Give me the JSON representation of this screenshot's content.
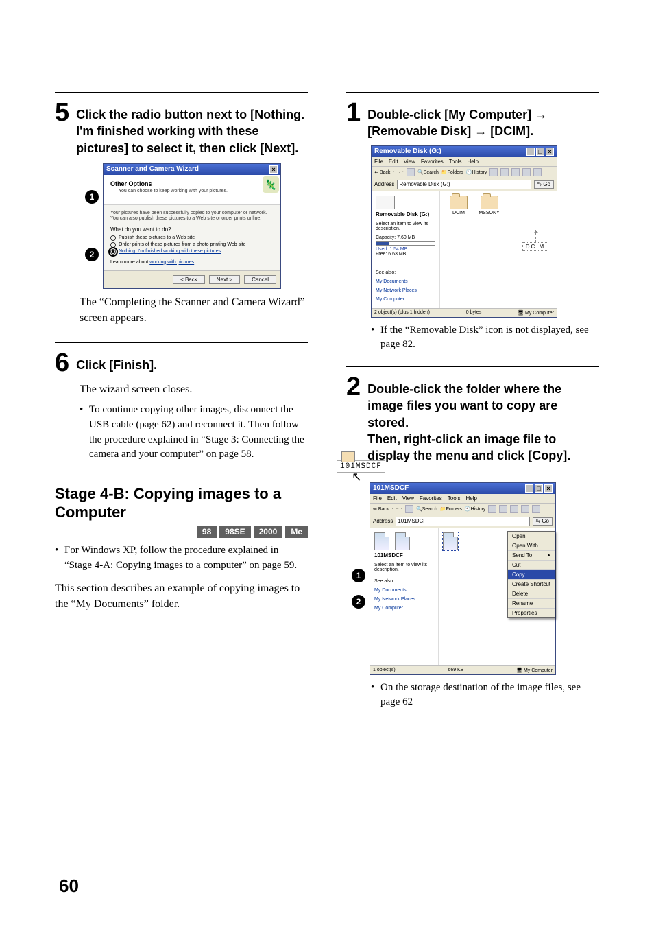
{
  "page_number": "60",
  "left": {
    "step5": {
      "num": "5",
      "text": "Click the radio button next to [Nothing. I'm finished working with these pictures] to select it, then click [Next].",
      "after": "The “Completing the Scanner and Camera Wizard” screen appears."
    },
    "step6": {
      "num": "6",
      "text": "Click [Finish].",
      "after": "The wizard screen closes.",
      "bullet": "To continue copying other images, disconnect the USB cable (page 62) and reconnect it. Then follow the procedure explained in “Stage 3: Connecting the camera and your computer” on page 58."
    },
    "stage": {
      "title": "Stage 4-B: Copying images to a Computer",
      "os": [
        "98",
        "98SE",
        "2000",
        "Me"
      ],
      "bullet": "For Windows XP, follow the procedure explained in “Stage 4-A: Copying images to a computer” on page 59.",
      "body": "This section describes an example of copying images to the “My Documents” folder."
    },
    "callouts": [
      "1",
      "2"
    ]
  },
  "right": {
    "step1": {
      "num": "1",
      "text": "Double-click [My Computer] → [Removable Disk] → [DCIM].",
      "bullet": "If the “Removable Disk” icon is not displayed, see page 82."
    },
    "step2": {
      "num": "2",
      "text": "Double-click the folder where the image files you want to copy are stored.\nThen, right-click an image file to display the menu and click [Copy].",
      "bullet": "On the storage destination of the image files, see page 62"
    },
    "callouts": [
      "1",
      "2"
    ]
  },
  "wizard": {
    "title": "Scanner and Camera Wizard",
    "close": "×",
    "head": "Other Options",
    "sub": "You can choose to keep working with your pictures.",
    "info": "Your pictures have been successfully copied to your computer or network. You can also publish these pictures to a Web site or order prints online.",
    "q": "What do you want to do?",
    "opt1": "Publish these pictures to a Web site",
    "opt2": "Order prints of these pictures from a photo printing Web site",
    "opt3": "Nothing. I'm finished working with these pictures",
    "learn": "Learn more about ",
    "learn_link": "working with pictures",
    "btn_back": "< Back",
    "btn_next": "Next >",
    "btn_cancel": "Cancel"
  },
  "explorer1": {
    "title": "Removable Disk (G:)",
    "menus": [
      "File",
      "Edit",
      "View",
      "Favorites",
      "Tools",
      "Help"
    ],
    "toolbar": {
      "back": "Back",
      "search": "Search",
      "folders": "Folders",
      "history": "History"
    },
    "address_label": "Address",
    "address_value": "Removable Disk (G:)",
    "go": "Go",
    "left_title": "Removable Disk (G:)",
    "select_hint": "Select an item to view its description.",
    "capacity_label": "Capacity: 7.60 MB",
    "used_label": "Used: 1.54 MB",
    "free_label": "Free: 6.63 MB",
    "see_also": "See also:",
    "links": [
      "My Documents",
      "My Network Places",
      "My Computer"
    ],
    "folders": [
      "DCIM",
      "MSSONY"
    ],
    "dcim_label": "DCIM",
    "status_left": "2 object(s) (plus 1 hidden)",
    "status_mid": "0 bytes",
    "status_right": "My Computer"
  },
  "explorer2": {
    "title": "101MSDCF",
    "menus": [
      "File",
      "Edit",
      "View",
      "Favorites",
      "Tools",
      "Help"
    ],
    "toolbar": {
      "back": "Back",
      "search": "Search",
      "folders": "Folders",
      "history": "History"
    },
    "address_label": "Address",
    "address_value": "101MSDCF",
    "go": "Go",
    "left_title": "101MSDCF",
    "select_hint": "Select an item to view its description.",
    "see_also": "See also:",
    "links": [
      "My Documents",
      "My Network Places",
      "My Computer"
    ],
    "folder_label": "101MSDCF",
    "ctx": {
      "open": "Open",
      "openwith": "Open With...",
      "sendto": "Send To",
      "cut": "Cut",
      "copy": "Copy",
      "shortcut": "Create Shortcut",
      "delete": "Delete",
      "rename": "Rename",
      "properties": "Properties"
    },
    "status_left": "1 object(s)",
    "status_mid": "669 KB",
    "status_right": "My Computer"
  }
}
